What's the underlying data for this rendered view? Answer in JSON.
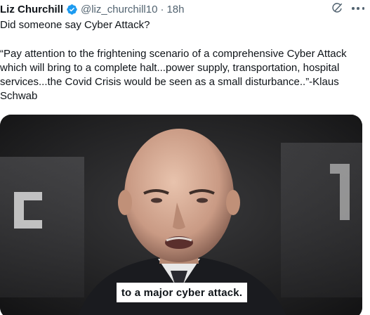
{
  "author": {
    "name": "Liz Churchill",
    "handle": "@liz_churchill10",
    "separator": "·",
    "time": "18h",
    "verified_color": "#1d9bf0"
  },
  "tweet": {
    "line1": "Did someone say Cyber Attack?",
    "quote": "“Pay attention to the frightening scenario of a comprehensive Cyber Attack which will bring to a complete halt...power supply, transportation, hospital services...the Covid Crisis would be seen as a small disturbance..”-Klaus Schwab"
  },
  "media": {
    "type": "video",
    "caption": "to a major cyber attack."
  },
  "icons": {
    "grok": "grok-icon",
    "more": "more-icon",
    "verified": "verified-badge-icon"
  }
}
